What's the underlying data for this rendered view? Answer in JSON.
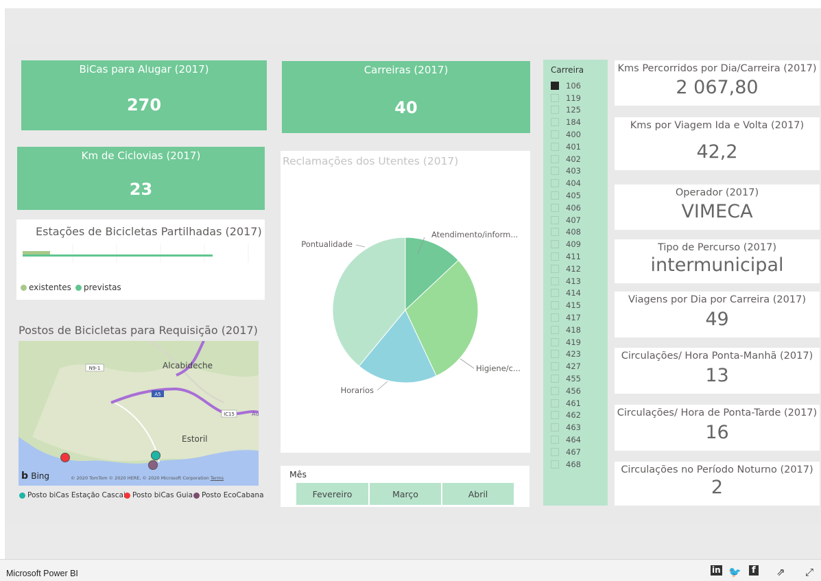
{
  "kpis": {
    "bicas": {
      "title": "BiCas para Alugar (2017)",
      "value": "270"
    },
    "carreiras": {
      "title": "Carreiras (2017)",
      "value": "40"
    },
    "ciclovias": {
      "title": "Km de Ciclovias (2017)",
      "value": "23"
    }
  },
  "estacoes": {
    "title": "Estações de Bicicletas Partilhadas (2017)",
    "legend": [
      {
        "label": "existentes",
        "color": "#a8c98a"
      },
      {
        "label": "previstas",
        "color": "#5fc58f"
      }
    ]
  },
  "map": {
    "title": "Postos de Bicicletas para Requisição (2017)",
    "place_labels": {
      "alcabideche": "Alcabideche",
      "estoril": "Estoril"
    },
    "road_labels": {
      "n9": "N9-1",
      "a5": "A5",
      "ic15": "IC15",
      "auto": "Auto"
    },
    "bing": "Bing",
    "copyright": "© 2020 TomTom © 2020 HERE, © 2020 Microsoft Corporation",
    "terms": "Terms",
    "legend": [
      {
        "label": "Posto biCas Estação Cascais",
        "color": "#1fb5a5"
      },
      {
        "label": "Posto biCas Guia",
        "color": "#f2353a"
      },
      {
        "label": "Posto EcoCabana",
        "color": "#7c4d6e"
      }
    ]
  },
  "chart_data": {
    "type": "pie",
    "title": "Reclamações dos Utentes (2017)",
    "categories": [
      "Atendimento/inform...",
      "Higiene/c...",
      "Horarios",
      "Pontualidade"
    ],
    "values": [
      13,
      30,
      18,
      39
    ],
    "colors": [
      "#70c997",
      "#98dc97",
      "#8fd3df",
      "#b8e4cc"
    ]
  },
  "mes": {
    "title": "Mês",
    "options": [
      "Fevereiro",
      "Março",
      "Abril"
    ]
  },
  "slicer": {
    "title": "Carreira",
    "items": [
      "106",
      "119",
      "125",
      "184",
      "400",
      "401",
      "402",
      "403",
      "404",
      "405",
      "406",
      "407",
      "408",
      "409",
      "411",
      "412",
      "413",
      "414",
      "415",
      "417",
      "418",
      "419",
      "423",
      "427",
      "455",
      "456",
      "461",
      "462",
      "463",
      "464",
      "467",
      "468"
    ],
    "selected": "106"
  },
  "cards": [
    {
      "title": "Kms Percorridos por Dia/Carreira (2017)",
      "value": "2 067,80"
    },
    {
      "title": "Kms por Viagem Ida e Volta (2017)",
      "value": "42,2"
    },
    {
      "title": "Operador (2017)",
      "value": "VIMECA"
    },
    {
      "title": "Tipo de Percurso (2017)",
      "value": "intermunicipal"
    },
    {
      "title": "Viagens por Dia por Carreira (2017)",
      "value": "49"
    },
    {
      "title": "Circulações/ Hora Ponta-Manhã (2017)",
      "value": "13"
    },
    {
      "title": "Circulações/ Hora de Ponta-Tarde (2017)",
      "value": "16"
    },
    {
      "title": "Circulações no Período Noturno (2017)",
      "value": "2"
    }
  ],
  "footer": {
    "brand": "Microsoft Power BI",
    "icons": [
      "linkedin-icon",
      "twitter-icon",
      "facebook-icon",
      "share-icon",
      "fullscreen-icon"
    ]
  }
}
